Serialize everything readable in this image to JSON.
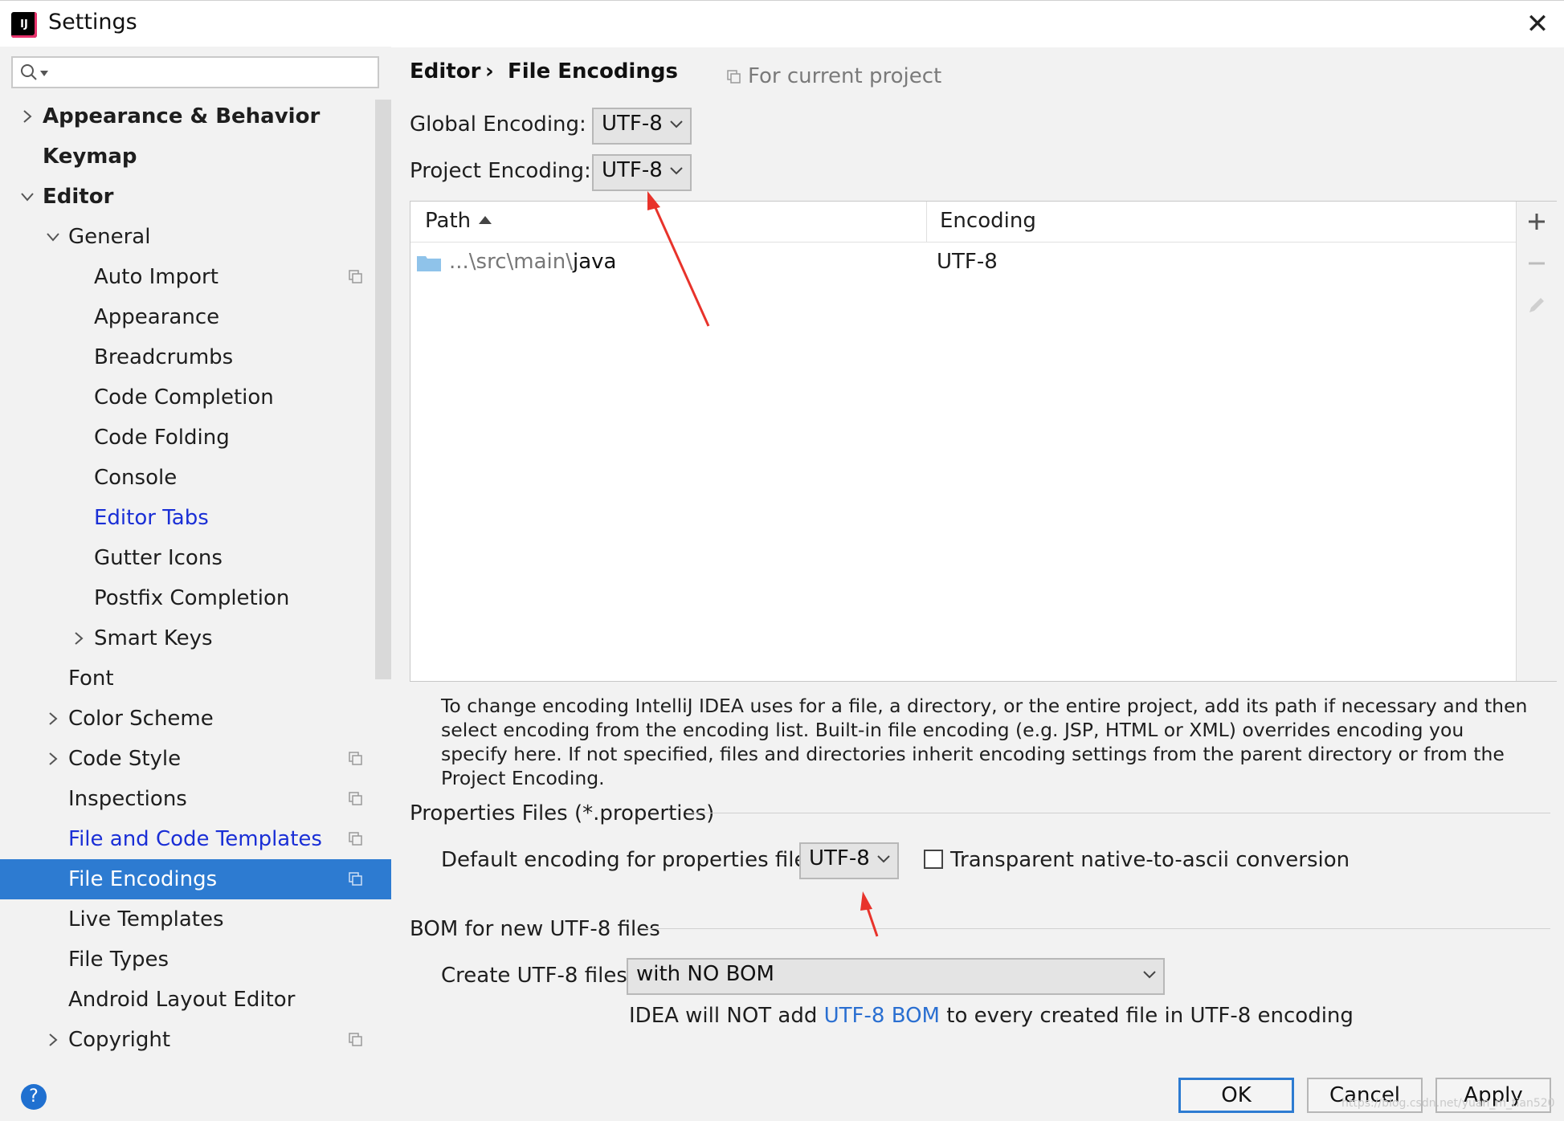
{
  "window": {
    "title": "Settings",
    "close_glyph": "✕",
    "app_icon_text": "IJ"
  },
  "search": {
    "placeholder": "",
    "icon": "search-icon"
  },
  "sidebar": {
    "items": [
      {
        "label": "Appearance & Behavior",
        "chevron": "right"
      },
      {
        "label": "Keymap"
      },
      {
        "label": "Editor",
        "chevron": "down"
      },
      {
        "label": "General",
        "chevron": "down"
      },
      {
        "label": "Auto Import",
        "copy": true
      },
      {
        "label": "Appearance"
      },
      {
        "label": "Breadcrumbs"
      },
      {
        "label": "Code Completion"
      },
      {
        "label": "Code Folding"
      },
      {
        "label": "Console"
      },
      {
        "label": "Editor Tabs"
      },
      {
        "label": "Gutter Icons"
      },
      {
        "label": "Postfix Completion"
      },
      {
        "label": "Smart Keys",
        "chevron": "right"
      },
      {
        "label": "Font"
      },
      {
        "label": "Color Scheme",
        "chevron": "right"
      },
      {
        "label": "Code Style",
        "chevron": "right",
        "copy": true
      },
      {
        "label": "Inspections",
        "copy": true
      },
      {
        "label": "File and Code Templates",
        "copy": true
      },
      {
        "label": "File Encodings",
        "copy": true,
        "selected": true
      },
      {
        "label": "Live Templates"
      },
      {
        "label": "File Types"
      },
      {
        "label": "Android Layout Editor"
      },
      {
        "label": "Copyright",
        "chevron": "right",
        "copy": true
      }
    ],
    "help_glyph": "?"
  },
  "breadcrumb": {
    "parent": "Editor",
    "separator": "›",
    "current": "File Encodings",
    "scope": "For current project"
  },
  "encodings": {
    "global_label": "Global Encoding:",
    "global_value": "UTF-8",
    "project_label": "Project Encoding:",
    "project_value": "UTF-8"
  },
  "table": {
    "columns": [
      "Path",
      "Encoding"
    ],
    "rows": [
      {
        "path_prefix": "...\\src\\main\\",
        "path_leaf": "java",
        "encoding": "UTF-8"
      }
    ],
    "toolbar": [
      "add-icon",
      "remove-icon",
      "edit-icon"
    ]
  },
  "help_text": "To change encoding IntelliJ IDEA uses for a file, a directory, or the entire project, add its path if necessary and then select encoding from the encoding list. Built-in file encoding (e.g. JSP, HTML or XML) overrides encoding you specify here. If not specified, files and directories inherit encoding settings from the parent directory or from the Project Encoding.",
  "properties": {
    "title": "Properties Files (*.properties)",
    "default_label": "Default encoding for properties files:",
    "default_value": "UTF-8",
    "transparent_label": "Transparent native-to-ascii conversion",
    "transparent_checked": false
  },
  "bom": {
    "title": "BOM for new UTF-8 files",
    "create_label": "Create UTF-8 files:",
    "create_value": "with NO BOM",
    "note_before": "IDEA will NOT add ",
    "note_link": "UTF-8 BOM",
    "note_after": " to every created file in UTF-8 encoding"
  },
  "buttons": {
    "ok": "OK",
    "cancel": "Cancel",
    "apply": "Apply"
  },
  "watermark": "https://blog.csdn.net/yuan_m_tian520",
  "colors": {
    "selection": "#2d7bd1",
    "link": "#1a2fd6",
    "annotation_arrow": "#e8332b"
  }
}
